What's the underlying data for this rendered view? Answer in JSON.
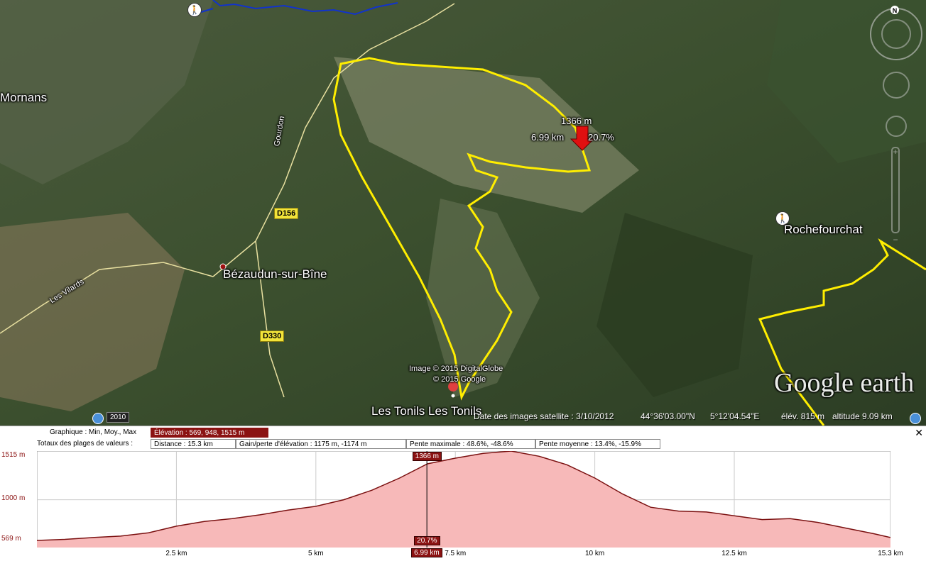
{
  "map": {
    "places": {
      "mornans": "Mornans",
      "bezaudun": "Bézaudun-sur-Bîne",
      "rochefourchat": "Rochefourchat",
      "tonils": "Les Tonils  Les Tonils",
      "gourdon": "Gourdon",
      "vilards": "Les Vilards"
    },
    "roads": {
      "d156": "D156",
      "d330": "D330"
    },
    "cursor": {
      "elev": "1366 m",
      "dist": "6.99 km",
      "grade": "20.7%"
    },
    "copyright": {
      "line1": "Image © 2015 DigitalGlobe",
      "line2": "© 2015 Google"
    },
    "logo": "Google earth",
    "history_year": "2010",
    "status": {
      "date": "Date des images satellite : 3/10/2012",
      "lat": "44°36'03.00\"N",
      "lon": "5°12'04.54\"E",
      "elev": "élév.  815 m",
      "altitude": "altitude   9.09 km"
    },
    "compass_n": "N",
    "colors": {
      "track": "#ffee00",
      "river": "#1133cc",
      "cursor": "#e01010"
    }
  },
  "profile": {
    "graph_label": "Graphique : Min, Moy., Max",
    "elevation": "Élévation : 569, 948, 1515 m",
    "totals_label": "Totaux des plages de valeurs :",
    "distance": "Distance : 15.3 km",
    "gain": "Gain/perte d'élévation : 1175 m, -1174 m",
    "max_slope": "Pente maximale : 48.6%, -48.6%",
    "avg_slope": "Pente moyenne : 13.4%, -15.9%",
    "close": "✕",
    "y_ticks": [
      "1515 m",
      "1000 m",
      "569 m"
    ],
    "x_ticks": [
      "2.5 km",
      "5 km",
      "7.5 km",
      "10 km",
      "12.5 km",
      "15.3 km"
    ],
    "cursor_elev": "1366 m",
    "cursor_grade": "20.7%",
    "cursor_dist": "6.99 km",
    "chart_data": {
      "type": "area",
      "x": [
        0,
        0.5,
        1,
        1.5,
        2,
        2.5,
        3,
        3.5,
        4,
        4.5,
        5,
        5.5,
        6,
        6.5,
        7,
        7.5,
        8,
        8.5,
        9,
        9.5,
        10,
        10.5,
        11,
        11.5,
        12,
        12.5,
        13,
        13.5,
        14,
        14.5,
        15,
        15.3
      ],
      "y": [
        569,
        580,
        600,
        615,
        650,
        720,
        770,
        800,
        840,
        890,
        930,
        1000,
        1100,
        1230,
        1380,
        1440,
        1490,
        1515,
        1460,
        1370,
        1230,
        1060,
        920,
        880,
        870,
        830,
        790,
        800,
        760,
        700,
        640,
        600
      ],
      "ylim": [
        569,
        1515
      ],
      "xlim": [
        0,
        15.3
      ],
      "cursor_x": 6.99,
      "colors": {
        "fill": "#f7b9b9",
        "line": "#7a1010"
      }
    }
  }
}
